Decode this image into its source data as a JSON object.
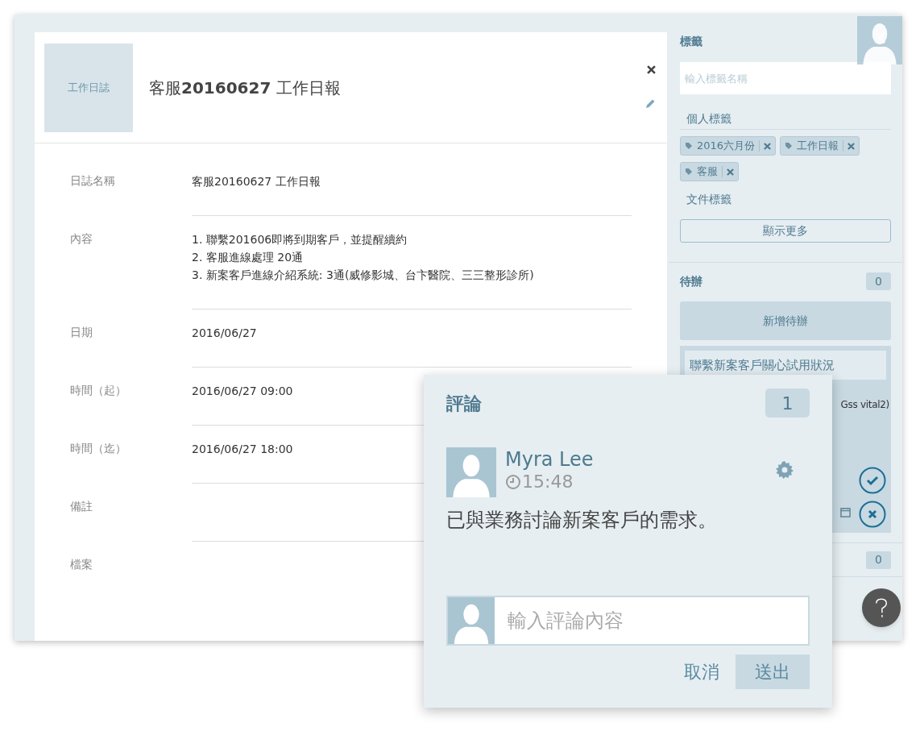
{
  "journal": {
    "thumbnail_label": "工作日誌",
    "title": "客服**20160627** 工作日報",
    "fields": [
      {
        "label": "日誌名稱",
        "lines": [
          "客服20160627 工作日報"
        ]
      },
      {
        "label": "內容",
        "lines": [
          "1. 聯繫201606即將到期客戶，並提醒續約",
          "2. 客服進線處理 20通",
          "3. 新案客戶進線介紹系統: 3通(威修影城、台卞醫院、三三整形診所)"
        ]
      },
      {
        "label": "日期",
        "lines": [
          "2016/06/27"
        ]
      },
      {
        "label": "時間（起）",
        "lines": [
          "2016/06/27 09:00"
        ]
      },
      {
        "label": "時間（迄）",
        "lines": [
          "2016/06/27 18:00"
        ]
      },
      {
        "label": "備註"
      },
      {
        "label": "檔案"
      }
    ]
  },
  "sidebar": {
    "tags": {
      "title": "標籤",
      "placeholder": "輸入標籤名稱",
      "personal_title": "個人標籤",
      "personal_tags": [
        "2016六月份",
        "工作日報",
        "客服"
      ],
      "document_title": "文件標籤",
      "more_button": "顯示更多"
    },
    "todo": {
      "title": "待辦",
      "count": "0",
      "add_button": "新增待辦",
      "card_title": "聯繫新案客戶關心試用狀況",
      "card_text": "Gss vital2)"
    },
    "section_3": {
      "count": "0"
    }
  },
  "comments": {
    "title": "評論",
    "count": "1",
    "author": "Myra Lee",
    "time": "15:48",
    "text": "已與業務討論新案客戶的需求。",
    "placeholder": "輸入評論內容",
    "cancel": "取消",
    "submit": "送出"
  }
}
